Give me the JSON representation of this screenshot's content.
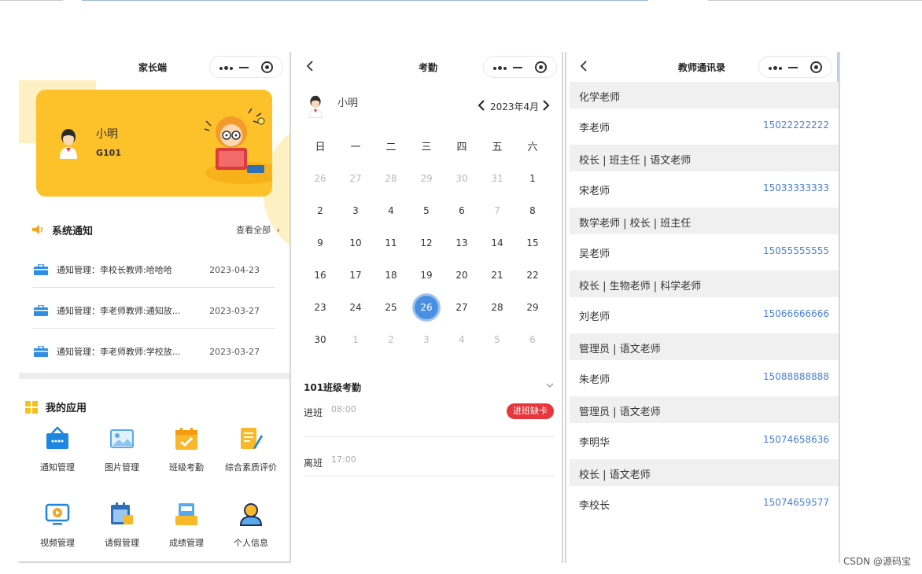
{
  "colors": {
    "accent_yellow": "#fdc12a",
    "accent_blue": "#4a90e2",
    "danger_red": "#e8363c",
    "phone_link": "#4a7fd6"
  },
  "parent_home": {
    "nav_title": "家长端",
    "profile": {
      "name": "小明",
      "class": "G101"
    },
    "notices": {
      "title": "系统通知",
      "view_all": "查看全部",
      "items": [
        {
          "text": "通知管理：李校长教师:哈哈哈",
          "date": "2023-04-23",
          "icon": "briefcase-icon"
        },
        {
          "text": "通知管理：李老师教师:通知放...",
          "date": "2023-03-27",
          "icon": "briefcase-icon"
        },
        {
          "text": "通知管理：李老师教师:学校放...",
          "date": "2023-03-27",
          "icon": "briefcase-icon"
        }
      ]
    },
    "apps": {
      "title": "我的应用",
      "items": [
        {
          "label": "通知管理",
          "icon": "notice-bag-icon"
        },
        {
          "label": "图片管理",
          "icon": "picture-icon"
        },
        {
          "label": "班级考勤",
          "icon": "calendar-check-icon"
        },
        {
          "label": "综合素质评价",
          "icon": "document-edit-icon"
        },
        {
          "label": "视频管理",
          "icon": "video-play-icon"
        },
        {
          "label": "请假管理",
          "icon": "leave-calendar-icon"
        },
        {
          "label": "成绩管理",
          "icon": "score-icon"
        },
        {
          "label": "个人信息",
          "icon": "user-icon"
        }
      ]
    }
  },
  "attendance": {
    "nav_title": "考勤",
    "user_name": "小明",
    "month": "2023年4月",
    "weekdays": [
      "日",
      "一",
      "二",
      "三",
      "四",
      "五",
      "六"
    ],
    "days": [
      {
        "n": "26",
        "dim": true
      },
      {
        "n": "27",
        "dim": true
      },
      {
        "n": "28",
        "dim": true
      },
      {
        "n": "29",
        "dim": true
      },
      {
        "n": "30",
        "dim": true
      },
      {
        "n": "31",
        "dim": true
      },
      {
        "n": "1"
      },
      {
        "n": "2"
      },
      {
        "n": "3"
      },
      {
        "n": "4"
      },
      {
        "n": "5"
      },
      {
        "n": "6"
      },
      {
        "n": "7",
        "dim": true
      },
      {
        "n": "8"
      },
      {
        "n": "9"
      },
      {
        "n": "10"
      },
      {
        "n": "11"
      },
      {
        "n": "12"
      },
      {
        "n": "13"
      },
      {
        "n": "14"
      },
      {
        "n": "15"
      },
      {
        "n": "16"
      },
      {
        "n": "17"
      },
      {
        "n": "18"
      },
      {
        "n": "19"
      },
      {
        "n": "20"
      },
      {
        "n": "21"
      },
      {
        "n": "22"
      },
      {
        "n": "23"
      },
      {
        "n": "24"
      },
      {
        "n": "25"
      },
      {
        "n": "26",
        "today": true
      },
      {
        "n": "27"
      },
      {
        "n": "28"
      },
      {
        "n": "29"
      },
      {
        "n": "30"
      },
      {
        "n": "1",
        "dim": true
      },
      {
        "n": "2",
        "dim": true
      },
      {
        "n": "3",
        "dim": true
      },
      {
        "n": "4",
        "dim": true
      },
      {
        "n": "5",
        "dim": true
      },
      {
        "n": "6",
        "dim": true
      }
    ],
    "section_title": "101班级考勤",
    "records": [
      {
        "label": "进班",
        "time": "08:00",
        "badge": "进班缺卡"
      },
      {
        "label": "离班",
        "time": "17:00",
        "badge": ""
      }
    ]
  },
  "contacts": {
    "nav_title": "教师通讯录",
    "groups": [
      {
        "role": "化学老师",
        "name": "李老师",
        "phone": "15022222222"
      },
      {
        "role": "校长 | 班主任 | 语文老师",
        "name": "宋老师",
        "phone": "15033333333"
      },
      {
        "role": "数学老师 | 校长 | 班主任",
        "name": "吴老师",
        "phone": "15055555555"
      },
      {
        "role": "校长 | 生物老师 | 科学老师",
        "name": "刘老师",
        "phone": "15066666666"
      },
      {
        "role": "管理员 | 语文老师",
        "name": "朱老师",
        "phone": "15088888888"
      },
      {
        "role": "管理员 | 语文老师",
        "name": "李明华",
        "phone": "15074658636"
      },
      {
        "role": "校长 | 语文老师",
        "name": "李校长",
        "phone": "15074659577"
      }
    ]
  },
  "watermark": "CSDN @源码宝"
}
